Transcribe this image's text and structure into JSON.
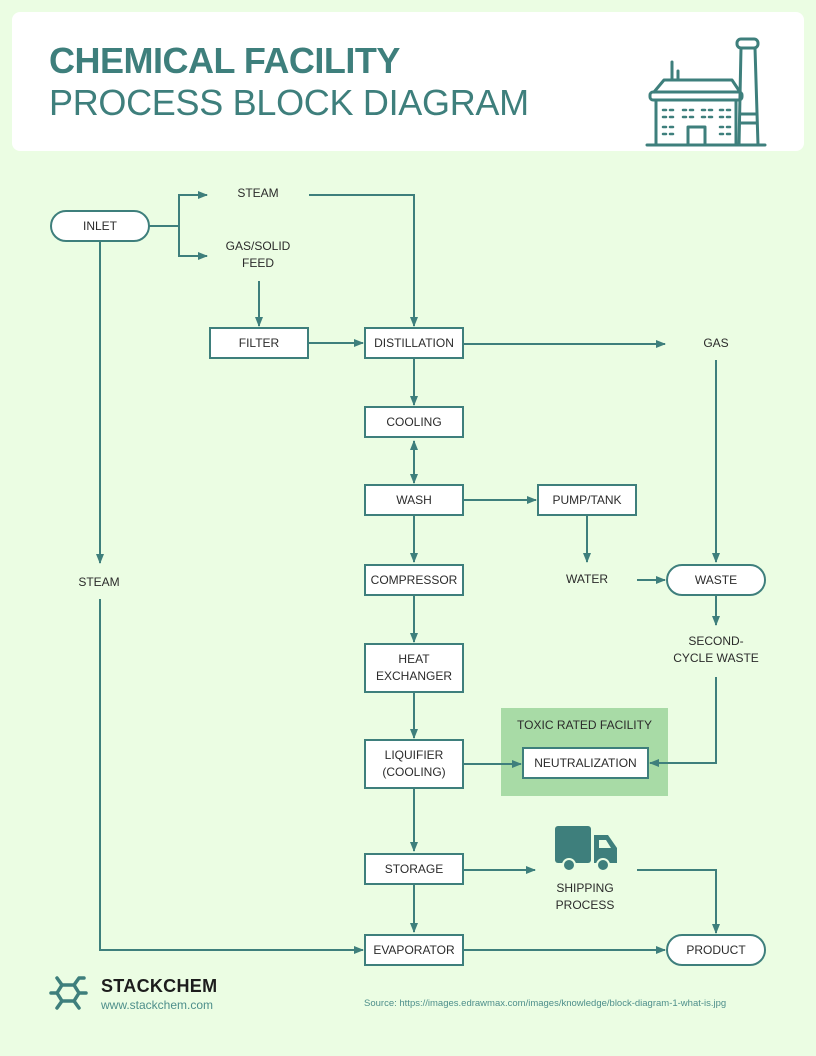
{
  "header": {
    "title_line1": "CHEMICAL FACILITY",
    "title_line2": "PROCESS BLOCK DIAGRAM",
    "icon": "factory-icon"
  },
  "colors": {
    "accent": "#3e7f7c",
    "background": "#ebfde3",
    "toxic_zone": "#a8dba6",
    "node_fill": "#ffffff"
  },
  "nodes": {
    "inlet": "INLET",
    "steam_top": "STEAM",
    "gas_solid_feed": [
      "GAS/SOLID",
      "FEED"
    ],
    "filter": "FILTER",
    "distillation": "DISTILLATION",
    "gas": "GAS",
    "cooling": "COOLING",
    "wash": "WASH",
    "pump_tank": "PUMP/TANK",
    "compressor": "COMPRESSOR",
    "water": "WATER",
    "waste": "WASTE",
    "steam_left": "STEAM",
    "heat_exchanger": [
      "HEAT",
      "EXCHANGER"
    ],
    "second_cycle_waste": [
      "SECOND-",
      "CYCLE WASTE"
    ],
    "liquifier": [
      "LIQUIFIER",
      "(COOLING)"
    ],
    "neutralization": "NEUTRALIZATION",
    "storage": "STORAGE",
    "shipping_process": [
      "SHIPPING",
      "PROCESS"
    ],
    "evaporator": "EVAPORATOR",
    "product": "PRODUCT"
  },
  "toxic_zone": {
    "title": "TOXIC RATED FACILITY"
  },
  "shipping_icon": "truck-icon",
  "edges": [
    {
      "from": "INLET",
      "to": "STEAM"
    },
    {
      "from": "INLET",
      "to": "GAS/SOLID FEED"
    },
    {
      "from": "INLET",
      "to": "STEAM (left)"
    },
    {
      "from": "STEAM",
      "to": "DISTILLATION"
    },
    {
      "from": "GAS/SOLID FEED",
      "to": "FILTER"
    },
    {
      "from": "FILTER",
      "to": "DISTILLATION"
    },
    {
      "from": "DISTILLATION",
      "to": "GAS"
    },
    {
      "from": "DISTILLATION",
      "to": "COOLING"
    },
    {
      "from": "COOLING",
      "to": "WASH",
      "bidirectional": true
    },
    {
      "from": "WASH",
      "to": "PUMP/TANK"
    },
    {
      "from": "WASH",
      "to": "COMPRESSOR"
    },
    {
      "from": "PUMP/TANK",
      "to": "WATER"
    },
    {
      "from": "WATER",
      "to": "WASTE"
    },
    {
      "from": "GAS",
      "to": "WASTE"
    },
    {
      "from": "WASTE",
      "to": "SECOND-CYCLE WASTE"
    },
    {
      "from": "SECOND-CYCLE WASTE",
      "to": "NEUTRALIZATION"
    },
    {
      "from": "COMPRESSOR",
      "to": "HEAT EXCHANGER"
    },
    {
      "from": "HEAT EXCHANGER",
      "to": "LIQUIFIER (COOLING)"
    },
    {
      "from": "LIQUIFIER (COOLING)",
      "to": "NEUTRALIZATION"
    },
    {
      "from": "LIQUIFIER (COOLING)",
      "to": "STORAGE"
    },
    {
      "from": "STORAGE",
      "to": "SHIPPING PROCESS"
    },
    {
      "from": "STORAGE",
      "to": "EVAPORATOR"
    },
    {
      "from": "SHIPPING PROCESS",
      "to": "PRODUCT"
    },
    {
      "from": "STEAM (left)",
      "to": "EVAPORATOR"
    },
    {
      "from": "EVAPORATOR",
      "to": "PRODUCT"
    }
  ],
  "footer": {
    "brand": "STACKCHEM",
    "url": "www.stackchem.com",
    "logo": "molecule-icon",
    "source": "Source: https://images.edrawmax.com/images/knowledge/block-diagram-1-what-is.jpg"
  }
}
